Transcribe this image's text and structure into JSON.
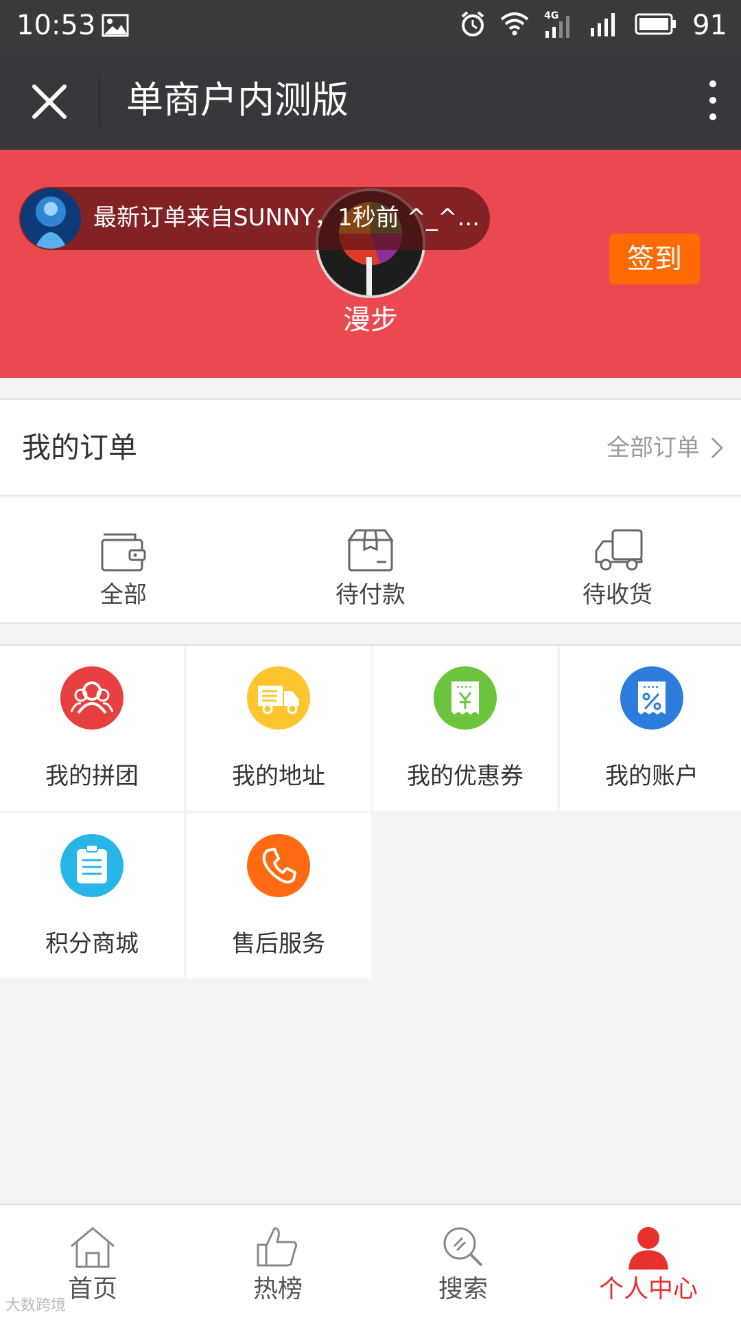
{
  "status_bar": {
    "time": "10:53",
    "network": "4G",
    "battery": "91"
  },
  "title_bar": {
    "title": "单商户内测版"
  },
  "profile": {
    "ticker_text": "最新订单来自SUNNY，1秒前 ^_^...",
    "username": "漫步",
    "signin_label": "签到"
  },
  "orders": {
    "heading": "我的订单",
    "all_orders_link": "全部订单",
    "items": [
      {
        "label": "全部",
        "icon": "wallet-icon"
      },
      {
        "label": "待付款",
        "icon": "package-icon"
      },
      {
        "label": "待收货",
        "icon": "truck-icon"
      }
    ]
  },
  "menu": {
    "items": [
      {
        "label": "我的拼团",
        "icon": "group-icon",
        "color": "#e84040"
      },
      {
        "label": "我的地址",
        "icon": "delivery-truck-icon",
        "color": "#ffc52f"
      },
      {
        "label": "我的优惠券",
        "icon": "coupon-icon",
        "color": "#6cc43d"
      },
      {
        "label": "我的账户",
        "icon": "account-discount-icon",
        "color": "#2e7ddd"
      },
      {
        "label": "积分商城",
        "icon": "clipboard-icon",
        "color": "#28b6e8"
      },
      {
        "label": "售后服务",
        "icon": "phone-icon",
        "color": "#ff6a12"
      }
    ]
  },
  "tabbar": {
    "tabs": [
      {
        "label": "首页",
        "icon": "home-icon"
      },
      {
        "label": "热榜",
        "icon": "thumbs-up-icon"
      },
      {
        "label": "搜索",
        "icon": "search-icon"
      },
      {
        "label": "个人中心",
        "icon": "person-icon",
        "active": true
      }
    ]
  },
  "watermark": "大数跨境",
  "colors": {
    "header_red": "#ea4a4f",
    "accent_orange": "#ff6a00",
    "active_red": "#e8302e"
  }
}
